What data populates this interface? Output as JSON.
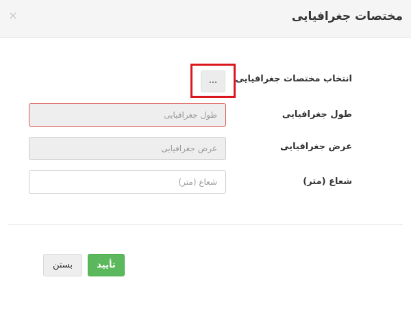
{
  "dialog": {
    "title": "مختصات جغرافیایی",
    "close_glyph": "×"
  },
  "form": {
    "select_coords_label": "انتخاب مختصات جغرافیایی",
    "picker_label": "...",
    "longitude_label": "طول جغرافیایی",
    "longitude_placeholder": "طول جغرافیایی",
    "latitude_label": "عرض جغرافیایی",
    "latitude_placeholder": "عرض جغرافیایی",
    "radius_label": "شعاع (متر)",
    "radius_placeholder": "شعاع (متر)"
  },
  "footer": {
    "confirm_label": "تأیید",
    "close_label": "بستن"
  },
  "colors": {
    "confirm": "#5cb85c",
    "highlight": "#d9171c",
    "error_border": "#d9534f"
  }
}
